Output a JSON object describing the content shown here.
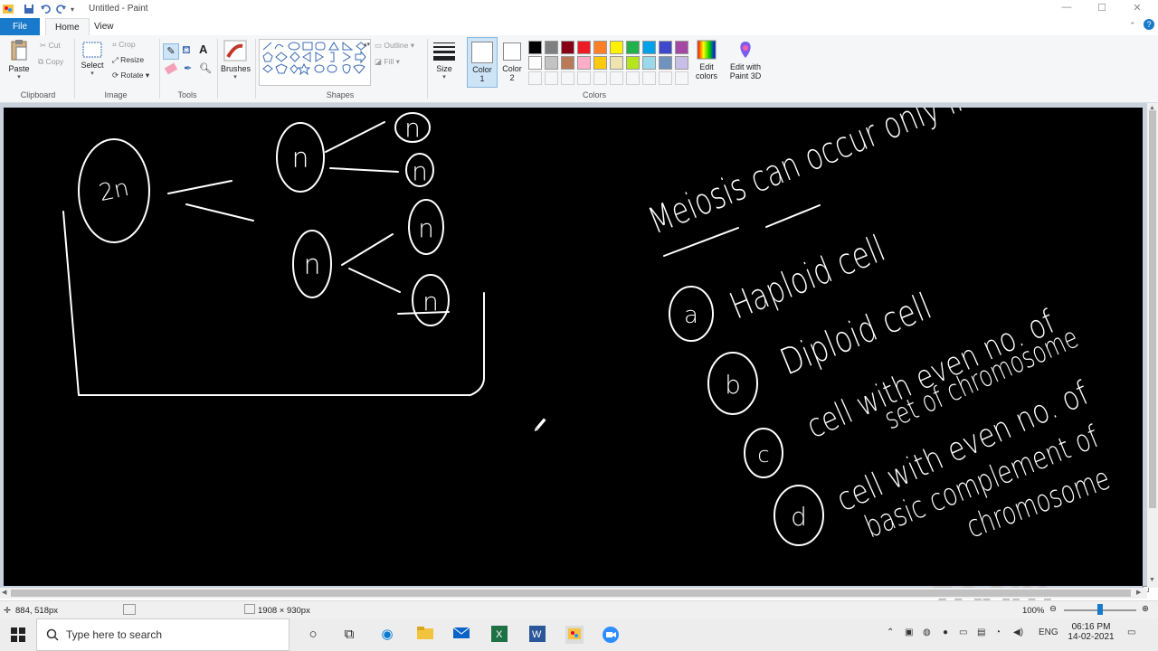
{
  "window": {
    "title": "Untitled - Paint",
    "controls": [
      "minimize-icon",
      "maximize-icon",
      "close-icon"
    ]
  },
  "tabs": [
    "File",
    "Home",
    "View"
  ],
  "ribbon": {
    "clipboard": {
      "label": "Clipboard",
      "paste": "Paste",
      "cut": "Cut",
      "copy": "Copy"
    },
    "image": {
      "label": "Image",
      "select": "Select",
      "crop": "Crop",
      "resize": "Resize",
      "rotate": "Rotate"
    },
    "tools": {
      "label": "Tools"
    },
    "brushes": {
      "label": "Brushes"
    },
    "shapes": {
      "label": "Shapes",
      "outline": "Outline",
      "fill": "Fill"
    },
    "size": {
      "label": "Size"
    },
    "color1": {
      "label": "Color",
      "num": "1"
    },
    "color2": {
      "label": "Color",
      "num": "2"
    },
    "colors": {
      "label": "Colors",
      "row1": [
        "#000000",
        "#7f7f7f",
        "#880015",
        "#ed1c24",
        "#ff7f27",
        "#fff200",
        "#22b14c",
        "#00a2e8",
        "#3f48cc",
        "#a349a4"
      ],
      "row2": [
        "#ffffff",
        "#c3c3c3",
        "#b97a57",
        "#ffaec9",
        "#ffc90e",
        "#efe4b0",
        "#b5e61d",
        "#99d9ea",
        "#7092be",
        "#c8bfe7"
      ],
      "edit_colors_1": "Edit",
      "edit_colors_2": "colors",
      "paint3d_1": "Edit with",
      "paint3d_2": "Paint 3D"
    }
  },
  "status": {
    "cursor": "884, 518px",
    "canvas_size": "1908 × 930px",
    "zoom": "100%"
  },
  "taskbar": {
    "search_placeholder": "Type here to search",
    "lang": "ENG",
    "time": "06:16 PM",
    "date": "14-02-2021"
  },
  "watermark": "zoom",
  "drawing": {
    "diagram": {
      "parent": "2n",
      "children": [
        "n",
        "n",
        "n",
        "n",
        "n",
        "n"
      ]
    },
    "question": "Meiosis can occur only in",
    "options": [
      {
        "letter": "a",
        "text": "Haploid cell"
      },
      {
        "letter": "b",
        "text": "Diploid cell"
      },
      {
        "letter": "c",
        "line1": "cell with even no. of",
        "line2": "set of chromosome"
      },
      {
        "letter": "d",
        "line1": "cell with even no. of",
        "line2": "basic complement of",
        "line3": "chromosome"
      }
    ]
  }
}
